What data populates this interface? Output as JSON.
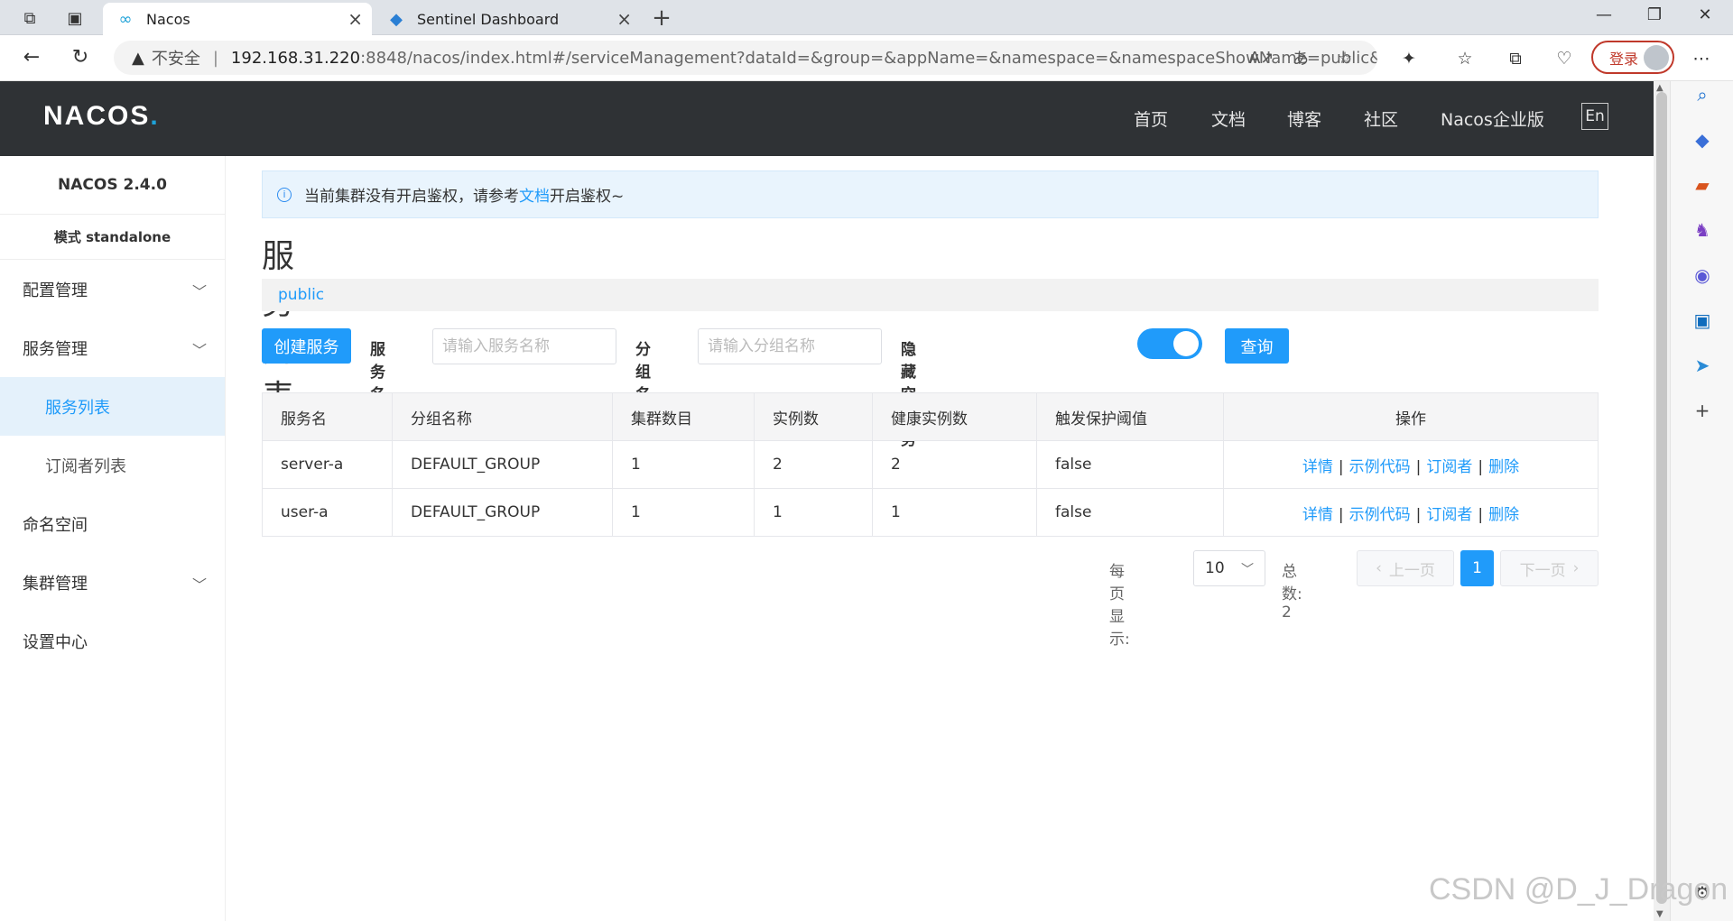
{
  "browser": {
    "tabs": [
      {
        "title": "Nacos",
        "icon": "nacos-infinity-icon"
      },
      {
        "title": "Sentinel Dashboard",
        "icon": "sentinel-icon"
      }
    ],
    "security_label": "不安全",
    "url_host": "192.168.31.220",
    "url_rest": ":8848/nacos/index.html#/serviceManagement?dataId=&group=&appName=&namespace=&namespaceShowName=public&s...",
    "login_label": "登录"
  },
  "header": {
    "logo": "NACOS",
    "logo_dot": ".",
    "nav": [
      "首页",
      "文档",
      "博客",
      "社区",
      "Nacos企业版"
    ],
    "lang": "En"
  },
  "menu": {
    "version": "NACOS 2.4.0",
    "mode": "模式 standalone",
    "items": [
      {
        "label": "配置管理"
      },
      {
        "label": "服务管理"
      },
      {
        "label": "服务列表"
      },
      {
        "label": "订阅者列表"
      },
      {
        "label": "命名空间"
      },
      {
        "label": "集群管理"
      },
      {
        "label": "设置中心"
      }
    ]
  },
  "notice": {
    "prefix": "当前集群没有开启鉴权，请参考",
    "link": "文档",
    "suffix": "开启鉴权~"
  },
  "page": {
    "title": "服务列表",
    "namespace": "public"
  },
  "filters": {
    "create_button": "创建服务",
    "service_name_label": "服务名称",
    "service_name_placeholder": "请输入服务名称",
    "group_name_label": "分组名称",
    "group_name_placeholder": "请输入分组名称",
    "hide_empty_label": "隐藏空服务",
    "hide_empty_enabled": true,
    "query_button": "查询"
  },
  "table": {
    "headers": [
      "服务名",
      "分组名称",
      "集群数目",
      "实例数",
      "健康实例数",
      "触发保护阈值",
      "操作"
    ],
    "rows": [
      {
        "service": "server-a",
        "group": "DEFAULT_GROUP",
        "clusters": "1",
        "instances": "2",
        "healthy": "2",
        "threshold": "false"
      },
      {
        "service": "user-a",
        "group": "DEFAULT_GROUP",
        "clusters": "1",
        "instances": "1",
        "healthy": "1",
        "threshold": "false"
      }
    ],
    "actions": [
      "详情",
      "示例代码",
      "订阅者",
      "删除"
    ]
  },
  "pagination": {
    "per_page_label": "每页显示:",
    "per_page_value": "10",
    "total_label": "总数: 2",
    "prev": "上一页",
    "current": "1",
    "next": "下一页"
  },
  "watermark": "CSDN @D_J_Dragon"
}
